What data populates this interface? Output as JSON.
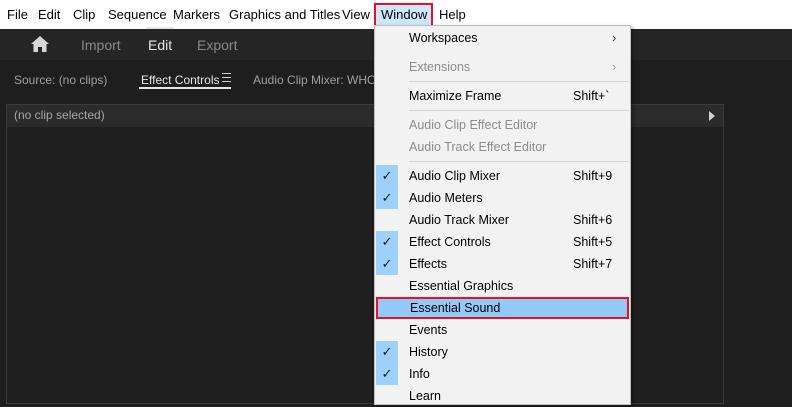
{
  "menubar": {
    "items": [
      "File",
      "Edit",
      "Clip",
      "Sequence",
      "Markers",
      "Graphics and Titles",
      "View",
      "Window",
      "Help"
    ],
    "active_index": 7
  },
  "header": {
    "home_icon": "home-icon",
    "tabs": [
      {
        "label": "Import",
        "active": false
      },
      {
        "label": "Edit",
        "active": true
      },
      {
        "label": "Export",
        "active": false
      }
    ]
  },
  "panel_tabs": {
    "source": "Source: (no clips)",
    "effect_controls": "Effect Controls",
    "audio_clip_mixer": "Audio Clip Mixer: WHOO"
  },
  "panel": {
    "no_clip_label": "(no clip selected)"
  },
  "window_menu": {
    "items": [
      {
        "label": "Workspaces",
        "arrow": "›",
        "checked": false,
        "disabled": false,
        "shortcut": ""
      },
      {
        "label": "Extensions",
        "arrow": "›",
        "checked": false,
        "disabled": true,
        "shortcut": ""
      },
      {
        "label": "Maximize Frame",
        "shortcut": "Shift+`",
        "checked": false,
        "disabled": false
      },
      {
        "label": "Audio Clip Effect Editor",
        "checked": false,
        "disabled": true,
        "shortcut": ""
      },
      {
        "label": "Audio Track Effect Editor",
        "checked": false,
        "disabled": true,
        "shortcut": ""
      },
      {
        "label": "Audio Clip Mixer",
        "shortcut": "Shift+9",
        "checked": true,
        "disabled": false
      },
      {
        "label": "Audio Meters",
        "shortcut": "",
        "checked": true,
        "disabled": false
      },
      {
        "label": "Audio Track Mixer",
        "shortcut": "Shift+6",
        "checked": false,
        "disabled": false
      },
      {
        "label": "Effect Controls",
        "shortcut": "Shift+5",
        "checked": true,
        "disabled": false
      },
      {
        "label": "Effects",
        "shortcut": "Shift+7",
        "checked": true,
        "disabled": false
      },
      {
        "label": "Essential Graphics",
        "shortcut": "",
        "checked": false,
        "disabled": false
      },
      {
        "label": "Essential Sound",
        "shortcut": "",
        "checked": false,
        "disabled": false,
        "highlighted": true
      },
      {
        "label": "Events",
        "shortcut": "",
        "checked": false,
        "disabled": false
      },
      {
        "label": "History",
        "shortcut": "",
        "checked": true,
        "disabled": false
      },
      {
        "label": "Info",
        "shortcut": "",
        "checked": true,
        "disabled": false
      },
      {
        "label": "Learn",
        "shortcut": "",
        "checked": false,
        "disabled": false
      }
    ],
    "check_glyph": "✓"
  },
  "colors": {
    "highlight_border": "#e81123",
    "highlight_fill": "#91c9f7",
    "check_fill": "#9dd1fb",
    "app_bg": "#1e1e1e"
  }
}
